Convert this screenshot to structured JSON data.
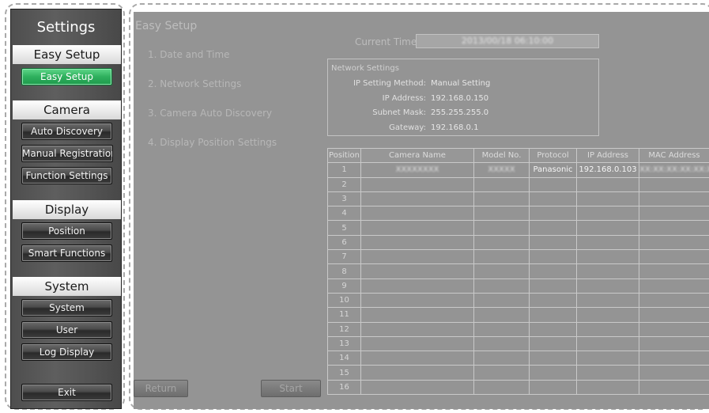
{
  "sidebar": {
    "title": "Settings",
    "sections": [
      {
        "header": "Easy Setup",
        "buttons": [
          "Easy Setup"
        ]
      },
      {
        "header": "Camera",
        "buttons": [
          "Auto Discovery",
          "Manual Registration",
          "Function Settings"
        ]
      },
      {
        "header": "Display",
        "buttons": [
          "Position",
          "Smart Functions"
        ]
      },
      {
        "header": "System",
        "buttons": [
          "System",
          "User",
          "Log Display"
        ]
      }
    ],
    "exit_label": "Exit",
    "active_button": "Easy Setup"
  },
  "main": {
    "title": "Easy Setup",
    "steps": [
      "1. Date and Time",
      "2. Network Settings",
      "3. Camera Auto Discovery",
      "4. Display Position Settings"
    ],
    "current_time_label": "Current Time",
    "current_time_value": "2013/00/18 06:10:00",
    "network": {
      "title": "Network Settings",
      "fields": [
        {
          "label": "IP Setting Method:",
          "value": "Manual Setting"
        },
        {
          "label": "IP Address:",
          "value": "192.168.0.150"
        },
        {
          "label": "Subnet Mask:",
          "value": "255.255.255.0"
        },
        {
          "label": "Gateway:",
          "value": "192.168.0.1"
        }
      ]
    },
    "table": {
      "columns": [
        "Position",
        "Camera Name",
        "Model No.",
        "Protocol",
        "IP Address",
        "MAC Address"
      ],
      "rows": [
        {
          "position": "1",
          "camera_name": "XXXXXXXX",
          "model_no": "XXXXX",
          "protocol": "Panasonic",
          "ip": "192.168.0.103",
          "mac": "XX:XX:XX:XX:XX:XX"
        },
        {
          "position": "2"
        },
        {
          "position": "3"
        },
        {
          "position": "4"
        },
        {
          "position": "5"
        },
        {
          "position": "6"
        },
        {
          "position": "7"
        },
        {
          "position": "8"
        },
        {
          "position": "9"
        },
        {
          "position": "10"
        },
        {
          "position": "11"
        },
        {
          "position": "12"
        },
        {
          "position": "13"
        },
        {
          "position": "14"
        },
        {
          "position": "15"
        },
        {
          "position": "16"
        }
      ]
    },
    "return_label": "Return",
    "start_label": "Start"
  },
  "colors": {
    "accent_green": "#2fb05e",
    "panel_gray": "#949494",
    "sidebar_dark": "#545454"
  }
}
